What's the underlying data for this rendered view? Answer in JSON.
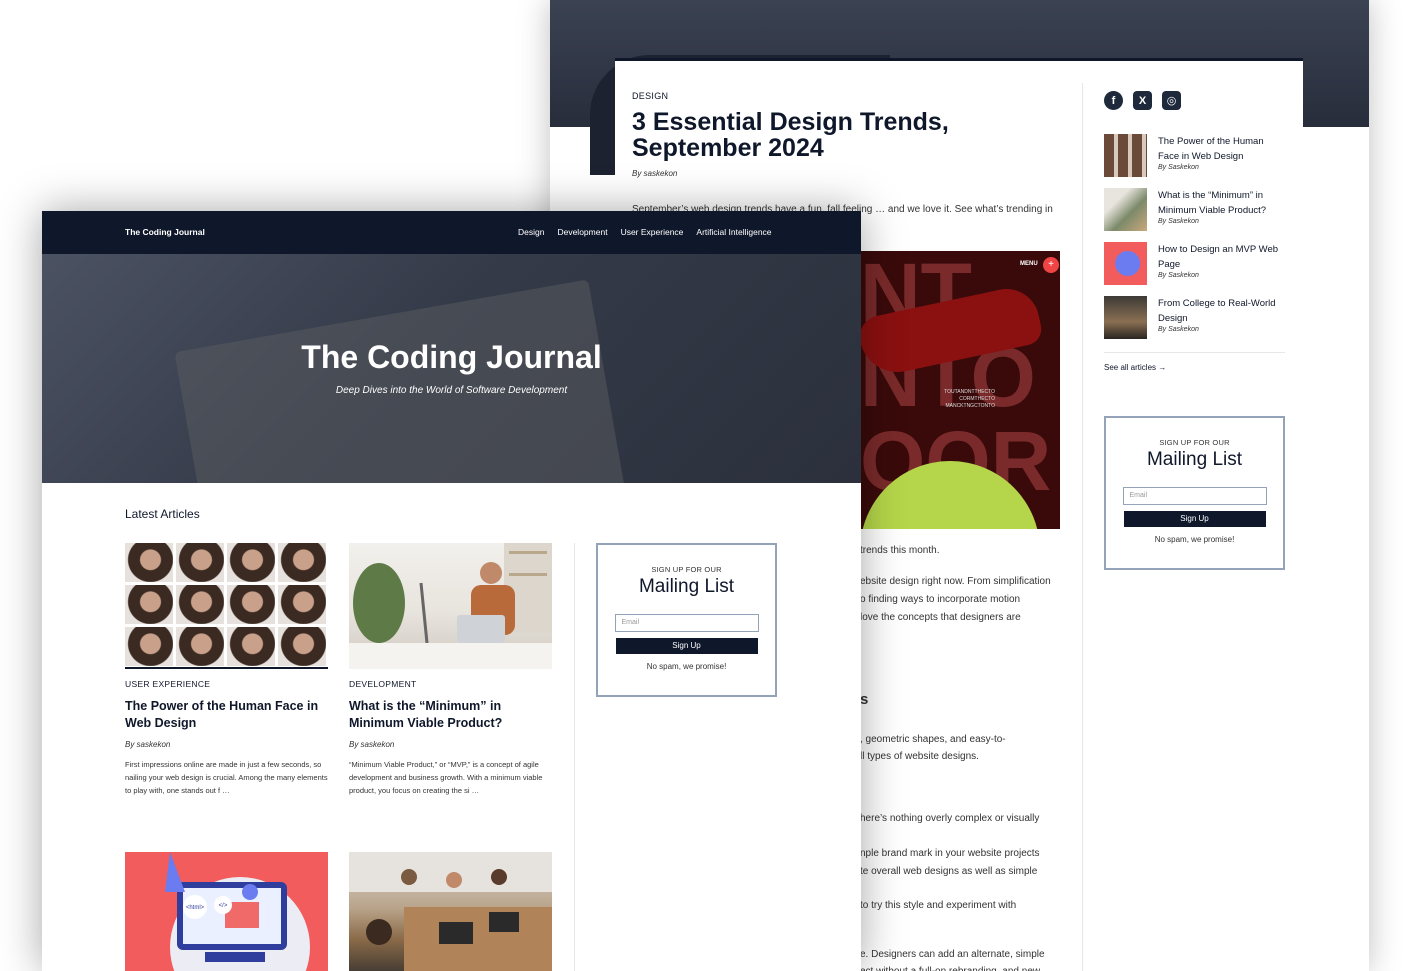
{
  "back_page": {
    "article": {
      "category": "DESIGN",
      "title_line1": "3 Essential Design Trends,",
      "title_line2": "September 2024",
      "byline": "By saskekon",
      "intro": "September’s web design trends have a fun, fall feeling … and we love it. See what’s trending in",
      "image_menu": "MENU",
      "image_menu_icon": "+",
      "image_small_text": "TOUTANDNTTHECTO CORMTHECTO MANCKTNGCTONTO",
      "fragments": [
        "trends this month.",
        "ebsite design right now. From simplification",
        "o finding ways to incorporate motion",
        "love the concepts that designers are",
        "s",
        ", geometric shapes, and easy-to-",
        "ll types of website designs.",
        "here’s nothing overly complex or visually",
        "nple brand mark in your website projects",
        "te overall web designs as well as simple",
        "to try this style and experiment with",
        "e. Designers can add an alternate, simple",
        "ect without a full-on rebranding, and new"
      ]
    },
    "sidebar": {
      "social": [
        {
          "icon": "facebook-icon",
          "glyph": "f"
        },
        {
          "icon": "x-icon",
          "glyph": "X"
        },
        {
          "icon": "instagram-icon",
          "glyph": "◎"
        }
      ],
      "articles": [
        {
          "title": "The Power of the Human Face in Web Design",
          "byline": "By Saskekon"
        },
        {
          "title": "What is the “Minimum” in Minimum Viable Product?",
          "byline": "By Saskekon"
        },
        {
          "title": "How to Design an MVP Web Page",
          "byline": "By Saskekon"
        },
        {
          "title": "From College to Real-World Design",
          "byline": "By Saskekon"
        }
      ],
      "see_all": "See all articles →"
    },
    "mailing": {
      "signup": "SIGN UP FOR OUR",
      "title": "Mailing List",
      "email_placeholder": "Email",
      "button": "Sign Up",
      "note": "No spam, we promise!"
    }
  },
  "front_page": {
    "nav": {
      "brand": "The Coding Journal",
      "links": [
        "Design",
        "Development",
        "User Experience",
        "Artificial Intelligence"
      ]
    },
    "hero": {
      "title": "The Coding Journal",
      "subtitle": "Deep Dives into the World of Software Development"
    },
    "latest_heading": "Latest Articles",
    "cards": [
      {
        "category": "USER EXPERIENCE",
        "title": "The Power of the Human Face in Web Design",
        "byline": "By saskekon",
        "excerpt": "First impressions online are made in just a few seconds, so nailing your web design is crucial. Among the many elements to play with, one stands out f …"
      },
      {
        "category": "DEVELOPMENT",
        "title": "What is the “Minimum” in Minimum Viable Product?",
        "byline": "By saskekon",
        "excerpt": "“Minimum Viable Product,” or “MVP,” is a concept of agile development and business growth. With a minimum viable product, you focus on creating the si …"
      }
    ],
    "mailing": {
      "signup": "SIGN UP FOR OUR",
      "title": "Mailing List",
      "email_placeholder": "Email",
      "button": "Sign Up",
      "note": "No spam, we promise!"
    },
    "card_image_labels": {
      "html_tag": "<html>",
      "code_tag": "</>"
    }
  },
  "colors": {
    "navy": "#0f172a",
    "accent_red": "#ef4444",
    "border_gray": "#94a3b8"
  }
}
